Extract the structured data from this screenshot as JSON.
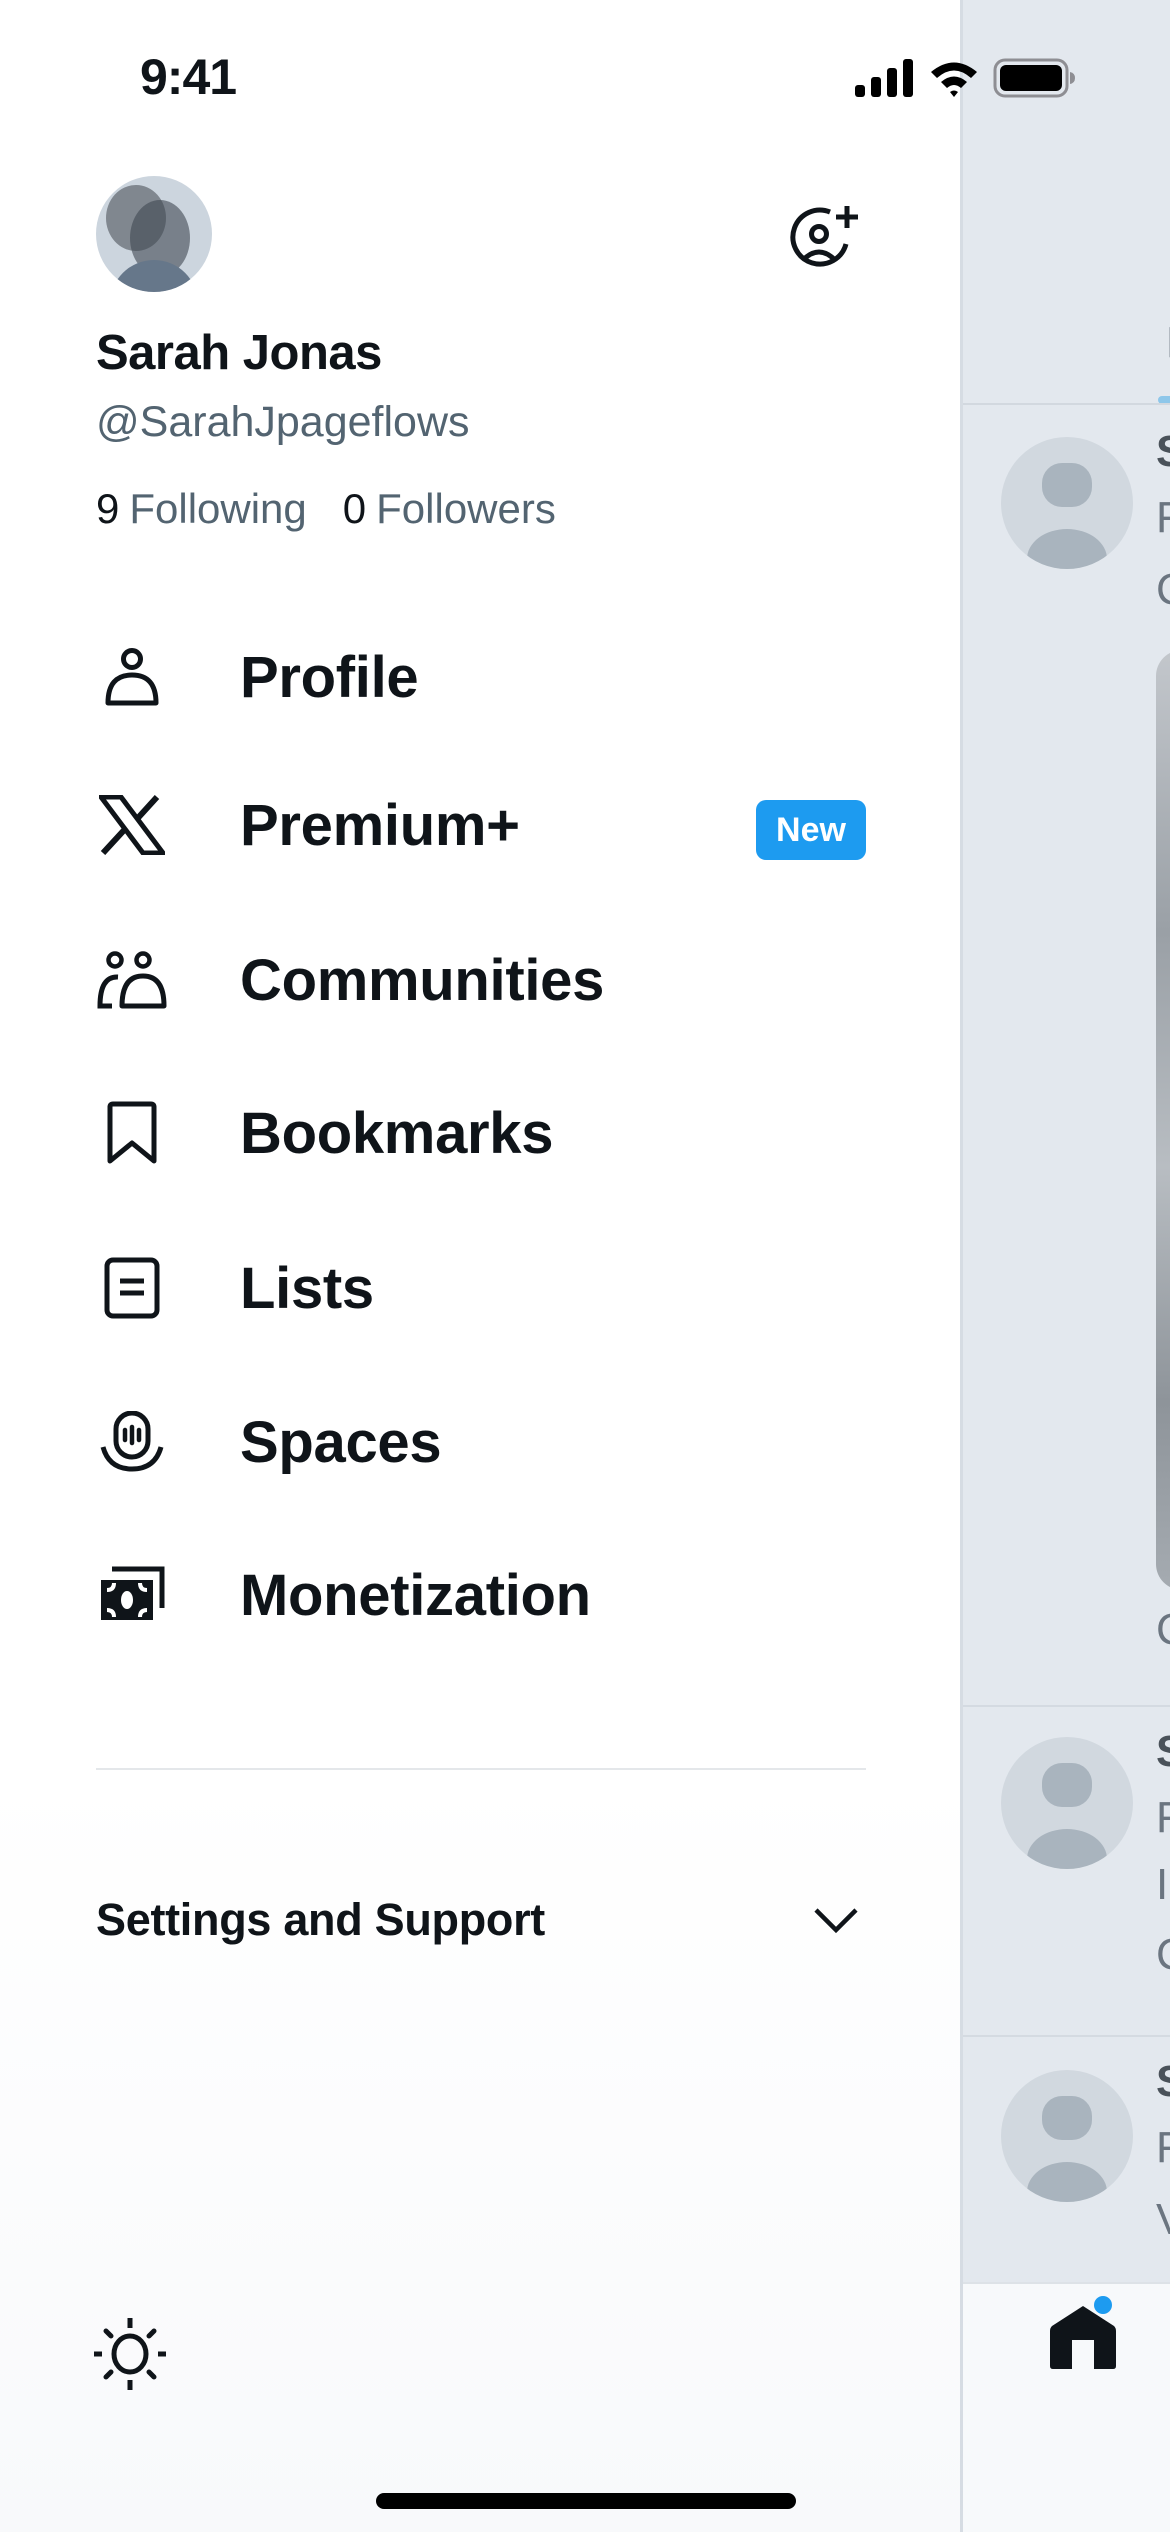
{
  "status_bar": {
    "time": "9:41",
    "icons": [
      "cellular-signal-icon",
      "wifi-icon",
      "battery-icon"
    ]
  },
  "account": {
    "name": "Sarah Jonas",
    "handle": "@SarahJpageflows",
    "following_count": "9",
    "following_label": "Following",
    "followers_count": "0",
    "followers_label": "Followers",
    "add_account_icon": "add-account-icon"
  },
  "menu": {
    "items": [
      {
        "label": "Profile",
        "icon": "person-icon"
      },
      {
        "label": "Premium+",
        "icon": "x-logo-icon",
        "badge": "New"
      },
      {
        "label": "Communities",
        "icon": "communities-icon"
      },
      {
        "label": "Bookmarks",
        "icon": "bookmark-icon"
      },
      {
        "label": "Lists",
        "icon": "lists-icon"
      },
      {
        "label": "Spaces",
        "icon": "spaces-icon"
      },
      {
        "label": "Monetization",
        "icon": "money-icon"
      }
    ]
  },
  "settings": {
    "label": "Settings and Support",
    "expanded": false
  },
  "footer": {
    "theme_icon": "sun-icon"
  },
  "background_feed": {
    "tab_initial": "F",
    "posts": [
      {
        "line1": "S",
        "line2": "F",
        "line3": "C",
        "footer": "C"
      },
      {
        "line1": "S",
        "line2": "F",
        "line3": "I",
        "footer": "C"
      },
      {
        "line1": "S",
        "line2": "F",
        "line3": "V"
      }
    ],
    "bottom_nav": {
      "active": "home",
      "has_notification_dot": true
    }
  },
  "colors": {
    "accent": "#1d9bf0",
    "text_primary": "#0f1419",
    "text_secondary": "#536471"
  }
}
